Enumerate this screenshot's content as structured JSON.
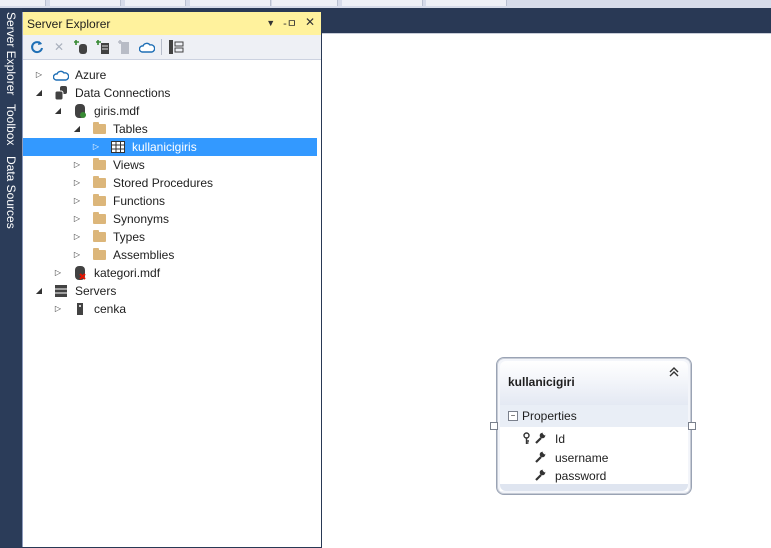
{
  "side_tabs": [
    "Server Explorer",
    "Toolbox",
    "Data Sources"
  ],
  "panel": {
    "title": "Server Explorer",
    "controls": {
      "dropdown": "▼",
      "pin": "-ㅁ",
      "close": "✕"
    },
    "toolbar": [
      "refresh-icon",
      "stop-icon",
      "connect-db-icon",
      "connect-server-icon",
      "delete-icon",
      "azure-icon",
      "properties-icon"
    ]
  },
  "tree": [
    {
      "label": "Azure",
      "icon": "azure-icon",
      "level": 0,
      "state": "collapsed"
    },
    {
      "label": "Data Connections",
      "icon": "data-connections-icon",
      "level": 0,
      "state": "expanded"
    },
    {
      "label": "giris.mdf",
      "icon": "database-icon",
      "level": 1,
      "state": "expanded"
    },
    {
      "label": "Tables",
      "icon": "folder-icon",
      "level": 2,
      "state": "expanded"
    },
    {
      "label": "kullanicigiris",
      "icon": "table-icon",
      "level": 3,
      "state": "collapsed",
      "selected": true
    },
    {
      "label": "Views",
      "icon": "folder-icon",
      "level": 2,
      "state": "collapsed"
    },
    {
      "label": "Stored Procedures",
      "icon": "folder-icon",
      "level": 2,
      "state": "collapsed"
    },
    {
      "label": "Functions",
      "icon": "folder-icon",
      "level": 2,
      "state": "collapsed"
    },
    {
      "label": "Synonyms",
      "icon": "folder-icon",
      "level": 2,
      "state": "collapsed"
    },
    {
      "label": "Types",
      "icon": "folder-icon",
      "level": 2,
      "state": "collapsed"
    },
    {
      "label": "Assemblies",
      "icon": "folder-icon",
      "level": 2,
      "state": "collapsed"
    },
    {
      "label": "kategori.mdf",
      "icon": "database-error-icon",
      "level": 1,
      "state": "collapsed"
    },
    {
      "label": "Servers",
      "icon": "servers-icon",
      "level": 0,
      "state": "expanded"
    },
    {
      "label": "cenka",
      "icon": "server-icon",
      "level": 1,
      "state": "collapsed"
    }
  ],
  "entity": {
    "title": "kullanicigiri",
    "section": "Properties",
    "properties": [
      {
        "name": "Id",
        "key": true
      },
      {
        "name": "username",
        "key": false
      },
      {
        "name": "password",
        "key": false
      }
    ]
  }
}
